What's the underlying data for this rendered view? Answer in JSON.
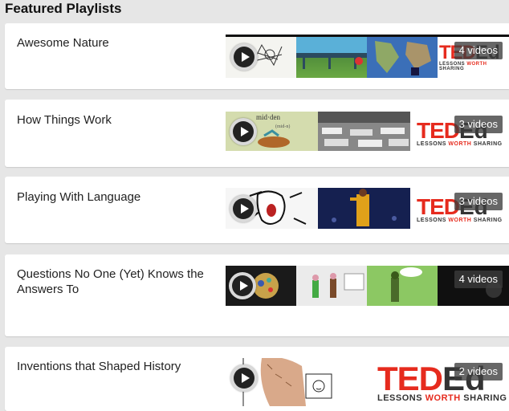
{
  "section": {
    "title": "Featured Playlists"
  },
  "playlists": [
    {
      "title": "Awesome Nature",
      "count": "4 videos"
    },
    {
      "title": "How Things Work",
      "count": "3 videos"
    },
    {
      "title": "Playing With Language",
      "count": "3 videos"
    },
    {
      "title": "Questions No One (Yet) Knows the Answers To",
      "count": "4 videos"
    },
    {
      "title": "Inventions that Shaped History",
      "count": "2 videos"
    }
  ],
  "brand": {
    "logo_text": "TED",
    "logo_suffix": "Ed",
    "tagline_pre": "LESSONS ",
    "tagline_accent": "WORTH",
    "tagline_post": " SHARING",
    "red": "#e62b1e"
  },
  "icons": {
    "play": "play-icon"
  }
}
